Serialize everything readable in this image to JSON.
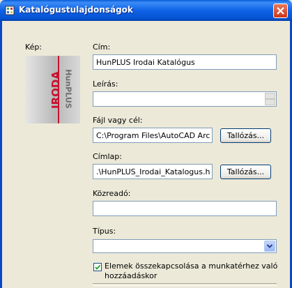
{
  "window": {
    "title": "Katalógustulajdonságok"
  },
  "image_label": "Kép:",
  "logo": {
    "top_text": "IRODA",
    "bottom_text": "HunPLUS"
  },
  "fields": {
    "cim": {
      "label": "Cím:",
      "value": "HunPLUS Irodai Katalógus"
    },
    "leiras": {
      "label": "Leírás:",
      "value": ""
    },
    "fajl": {
      "label": "Fájl vagy cél:",
      "value": "C:\\Program Files\\AutoCAD Archite",
      "button": "Tallózás..."
    },
    "cimlap": {
      "label": "Címlap:",
      "value": ".\\HunPLUS_Irodai_Katalogus.html",
      "button": "Tallózás..."
    },
    "kozreado": {
      "label": "Közreadó:",
      "value": ""
    },
    "tipus": {
      "label": "Típus:",
      "value": ""
    }
  },
  "checkbox": {
    "label_line1": "Elemek összekapcsolása a munkatérhez való",
    "label_line2": "hozzáadáskor",
    "checked": true
  }
}
